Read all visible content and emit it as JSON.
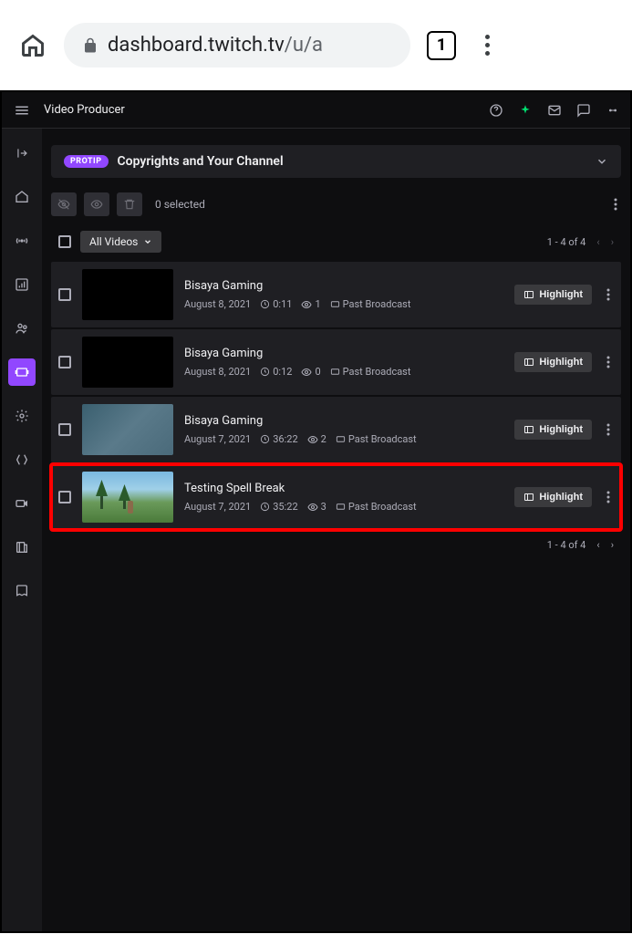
{
  "browser": {
    "url_host": "dashboard.twitch.tv",
    "url_path": "/u/a",
    "tab_count": "1"
  },
  "header": {
    "title": "Video Producer"
  },
  "banner": {
    "badge": "PROTIP",
    "title": "Copyrights and Your Channel"
  },
  "toolbar": {
    "selected_text": "0 selected"
  },
  "filter": {
    "dropdown_label": "All Videos"
  },
  "pagination": {
    "range": "1 - 4 of 4"
  },
  "highlight_label": "Highlight",
  "videos": [
    {
      "title": "Bisaya Gaming",
      "date": "August 8, 2021",
      "duration": "0:11",
      "views": "1",
      "type": "Past Broadcast",
      "thumb_class": "",
      "highlighted": false
    },
    {
      "title": "Bisaya Gaming",
      "date": "August 8, 2021",
      "duration": "0:12",
      "views": "0",
      "type": "Past Broadcast",
      "thumb_class": "",
      "highlighted": false
    },
    {
      "title": "Bisaya Gaming",
      "date": "August 7, 2021",
      "duration": "36:22",
      "views": "2",
      "type": "Past Broadcast",
      "thumb_class": "game1",
      "highlighted": false
    },
    {
      "title": "Testing Spell Break",
      "date": "August 7, 2021",
      "duration": "35:22",
      "views": "3",
      "type": "Past Broadcast",
      "thumb_class": "game2",
      "highlighted": true
    }
  ]
}
